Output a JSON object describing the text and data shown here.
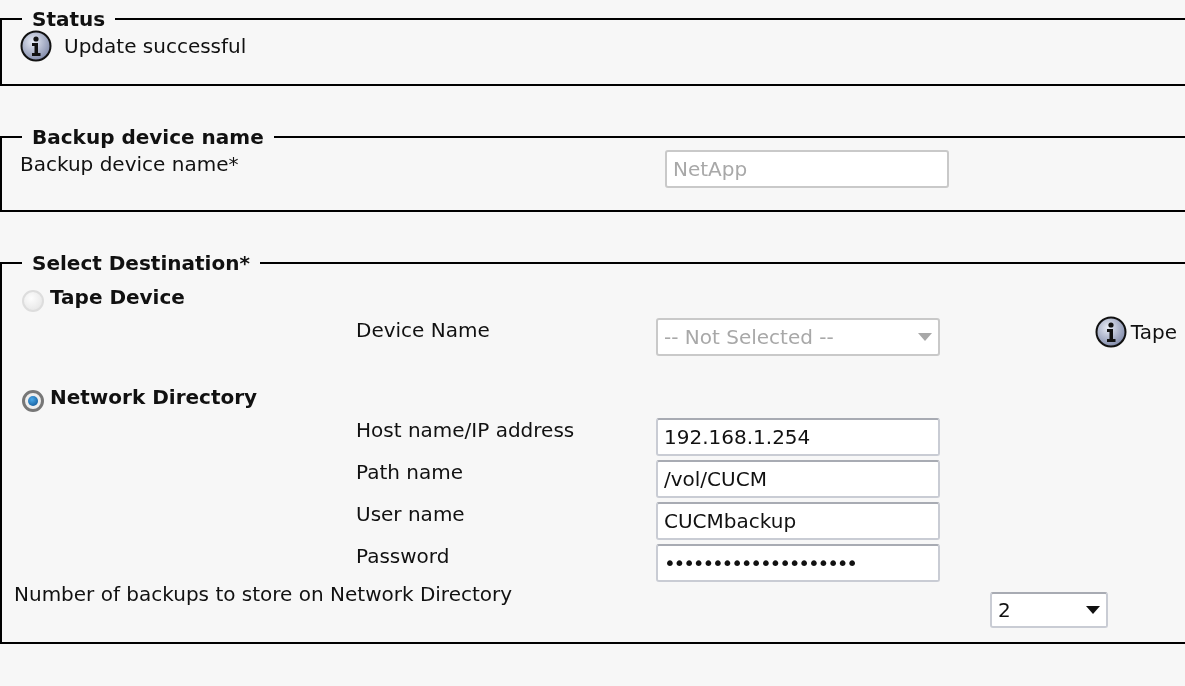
{
  "status": {
    "legend": "Status",
    "message": "Update successful"
  },
  "backup_device": {
    "legend": "Backup device name",
    "label": "Backup device name*",
    "value": "NetApp",
    "disabled": true
  },
  "destination": {
    "legend": "Select Destination*",
    "options": [
      {
        "label": "Tape Device",
        "selected": false,
        "note": "Tape",
        "fields": [
          {
            "kind": "select",
            "label": "Device Name",
            "value": "-- Not Selected --",
            "disabled": true
          }
        ]
      },
      {
        "label": "Network Directory",
        "selected": true,
        "fields": [
          {
            "kind": "text",
            "label": "Host name/IP address",
            "value": "192.168.1.254"
          },
          {
            "kind": "text",
            "label": "Path name",
            "value": "/vol/CUCM"
          },
          {
            "kind": "text",
            "label": "User name",
            "value": "CUCMbackup"
          },
          {
            "kind": "password",
            "label": "Password",
            "value": "••••••••••••••••••••"
          }
        ]
      }
    ],
    "backups_count": {
      "label": "Number of backups to store on Network Directory",
      "value": "2"
    }
  }
}
